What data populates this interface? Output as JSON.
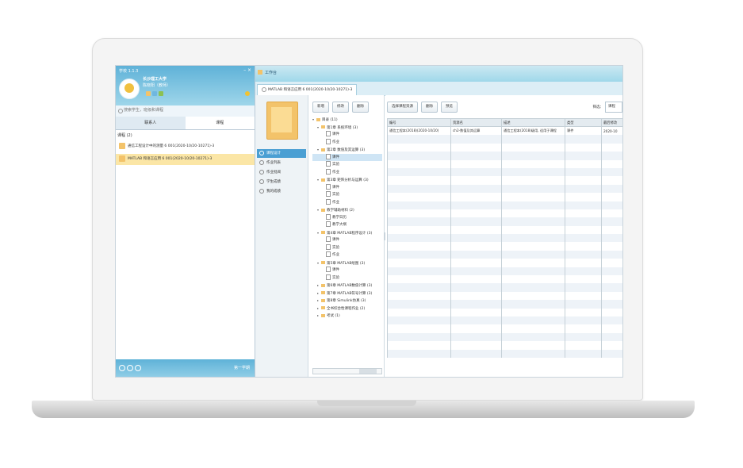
{
  "app": {
    "version": "学校 1.1.3",
    "window_controls": "– ×"
  },
  "user": {
    "school": "长沙理工大学",
    "name": "陈晓阳（教师）"
  },
  "search": {
    "placeholder": "搜索学生，班级和课程"
  },
  "left_tabs": [
    "联系人",
    "课程"
  ],
  "course_group": "课程 (2)",
  "courses": [
    {
      "label": "通信工程设计中的测量 6 001(2020-10/20-10271)-3",
      "selected": false
    },
    {
      "label": "MATLAB 和语言应用 6 001(2020-10/20-10271)-3",
      "selected": true
    }
  ],
  "footer": {
    "status": "第一学期"
  },
  "workspace": {
    "title": "工作台",
    "tab": "MATLAB 和语言应用 6 001(2020-10/20-10271)-3"
  },
  "nav_items": [
    {
      "label": "课程设计",
      "icon": "grid-icon",
      "active": true
    },
    {
      "label": "作业列表",
      "icon": "list-icon",
      "active": false
    },
    {
      "label": "作业批阅",
      "icon": "check-icon",
      "active": false
    },
    {
      "label": "学生成绩",
      "icon": "chart-icon",
      "active": false
    },
    {
      "label": "我的成绩",
      "icon": "star-icon",
      "active": false
    }
  ],
  "tree_buttons": [
    "新增",
    "修改",
    "删除"
  ],
  "tree": [
    {
      "label": "目录 (11)",
      "type": "folder",
      "indent": 0,
      "arrow": "▾"
    },
    {
      "label": "第1章 系统环境 (3)",
      "type": "folder",
      "indent": 1,
      "arrow": "▾"
    },
    {
      "label": "课件",
      "type": "page",
      "indent": 2,
      "arrow": ""
    },
    {
      "label": "作业",
      "type": "page",
      "indent": 2,
      "arrow": ""
    },
    {
      "label": "第2章 数值及其运算 (3)",
      "type": "folder",
      "indent": 1,
      "arrow": "▾"
    },
    {
      "label": "课件",
      "type": "page",
      "indent": 2,
      "arrow": "",
      "selected": true
    },
    {
      "label": "实验",
      "type": "page",
      "indent": 2,
      "arrow": ""
    },
    {
      "label": "作业",
      "type": "page",
      "indent": 2,
      "arrow": ""
    },
    {
      "label": "第3章 矩阵分析与运算 (3)",
      "type": "folder",
      "indent": 1,
      "arrow": "▾"
    },
    {
      "label": "课件",
      "type": "page",
      "indent": 2,
      "arrow": ""
    },
    {
      "label": "实验",
      "type": "page",
      "indent": 2,
      "arrow": ""
    },
    {
      "label": "作业",
      "type": "page",
      "indent": 2,
      "arrow": ""
    },
    {
      "label": "教学辅助材料 (2)",
      "type": "folder",
      "indent": 1,
      "arrow": "▾"
    },
    {
      "label": "教学日历",
      "type": "page",
      "indent": 2,
      "arrow": ""
    },
    {
      "label": "教学大纲",
      "type": "page",
      "indent": 2,
      "arrow": ""
    },
    {
      "label": "第4章 MATLAB程序设计 (3)",
      "type": "folder",
      "indent": 1,
      "arrow": "▾"
    },
    {
      "label": "课件",
      "type": "page",
      "indent": 2,
      "arrow": ""
    },
    {
      "label": "实验",
      "type": "page",
      "indent": 2,
      "arrow": ""
    },
    {
      "label": "作业",
      "type": "page",
      "indent": 2,
      "arrow": ""
    },
    {
      "label": "第5章 MATLAB绘图 (3)",
      "type": "folder",
      "indent": 1,
      "arrow": "▾"
    },
    {
      "label": "课件",
      "type": "page",
      "indent": 2,
      "arrow": ""
    },
    {
      "label": "实验",
      "type": "page",
      "indent": 2,
      "arrow": ""
    },
    {
      "label": "第6章 MATLAB数值计算 (3)",
      "type": "folder",
      "indent": 1,
      "arrow": "▸"
    },
    {
      "label": "第7章 MATLAB符号计算 (3)",
      "type": "folder",
      "indent": 1,
      "arrow": "▸"
    },
    {
      "label": "第8章 Simulink仿真 (3)",
      "type": "folder",
      "indent": 1,
      "arrow": "▸"
    },
    {
      "label": "全书综合性课程作业 (2)",
      "type": "folder",
      "indent": 1,
      "arrow": "▸"
    },
    {
      "label": "考试 (1)",
      "type": "folder",
      "indent": 1,
      "arrow": "▸"
    }
  ],
  "grid_buttons": [
    "选择课程资源",
    "删除",
    "预览"
  ],
  "filter": {
    "label": "筛选：",
    "value": "课程"
  },
  "table": {
    "columns": [
      "编号",
      "资源名",
      "描述",
      "类型",
      "最后修改"
    ],
    "rows": [
      [
        "通信工程本(2018)(2020-10/20)",
        "ch2-数值及其运算",
        "通信工程本(2018)级用, 适用于课程",
        "课件",
        "2020-10"
      ]
    ]
  }
}
